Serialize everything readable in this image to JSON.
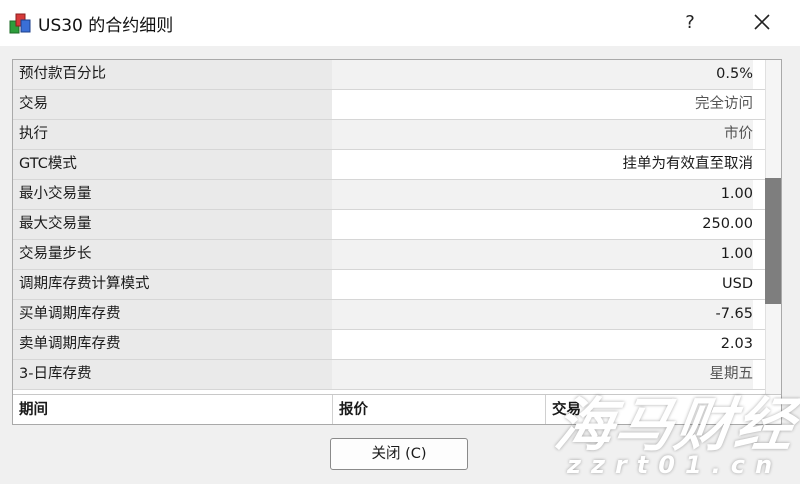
{
  "window": {
    "title": "US30 的合约细则",
    "help_glyph": "?"
  },
  "rows": [
    {
      "label": "预付款百分比",
      "value": "0.5%"
    },
    {
      "label": "交易",
      "value": "完全访问"
    },
    {
      "label": "执行",
      "value": "市价"
    },
    {
      "label": "GTC模式",
      "value": "挂单为有效直至取消"
    },
    {
      "label": "最小交易量",
      "value": "1.00"
    },
    {
      "label": "最大交易量",
      "value": "250.00"
    },
    {
      "label": "交易量步长",
      "value": "1.00"
    },
    {
      "label": "调期库存费计算模式",
      "value": "USD"
    },
    {
      "label": "买单调期库存费",
      "value": "-7.65"
    },
    {
      "label": "卖单调期库存费",
      "value": "2.03"
    },
    {
      "label": "3-日库存费",
      "value": "星期五"
    }
  ],
  "columns": [
    "期间",
    "报价",
    "交易"
  ],
  "buttons": {
    "close_label": "关闭 (C)"
  },
  "watermark": {
    "name": "海马财经",
    "url": "zzrt01.cn"
  },
  "scroll": {
    "position": 0.35,
    "visible_fraction": 0.38
  }
}
